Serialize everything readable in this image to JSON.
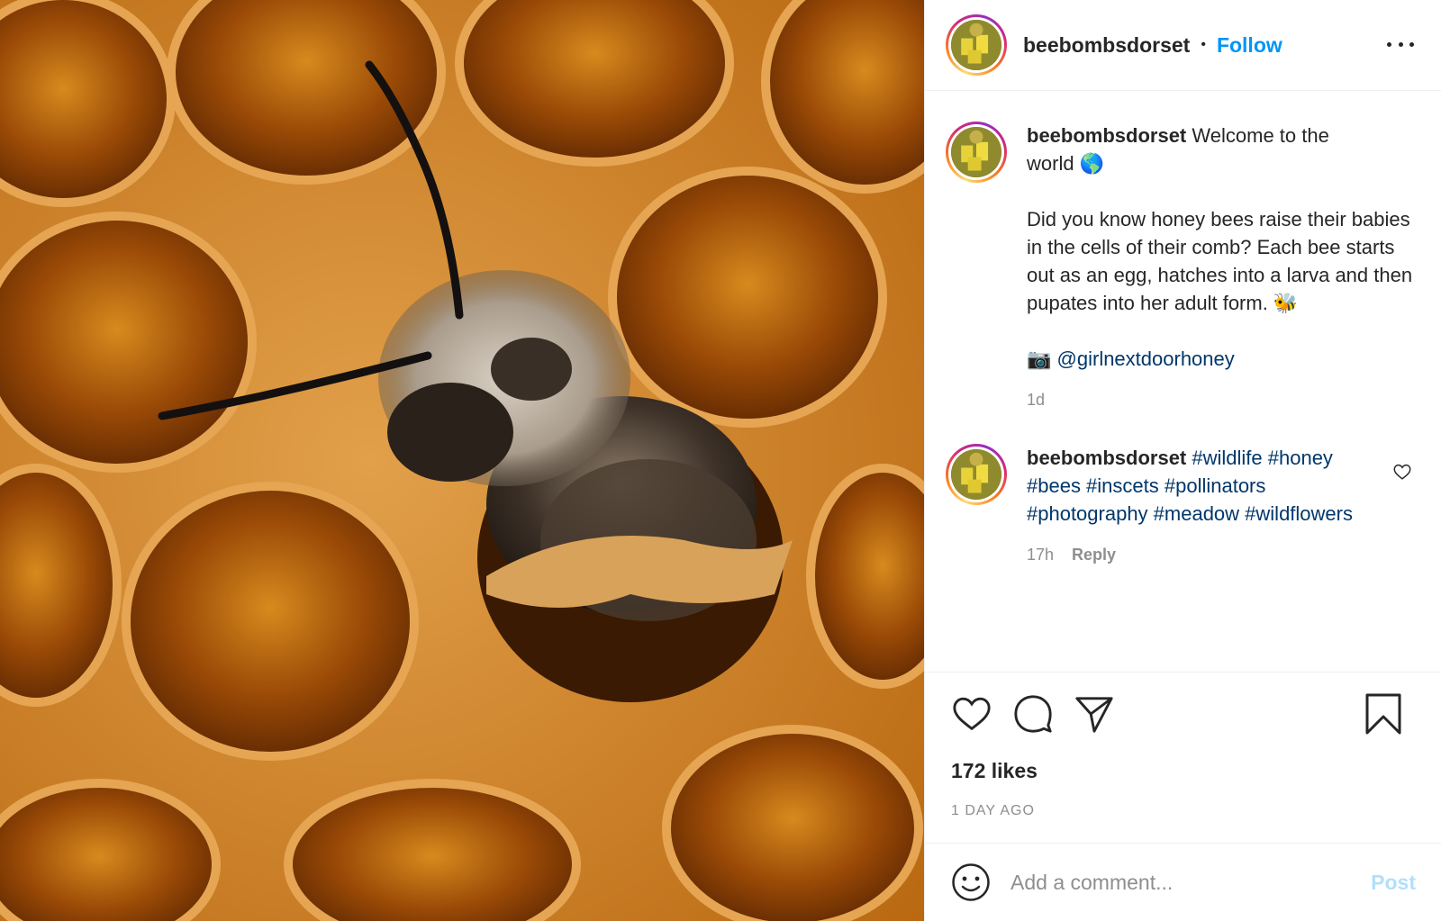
{
  "post": {
    "username": "beebombsdorset",
    "follow_label": "Follow",
    "separator": "•"
  },
  "caption": {
    "username": "beebombsdorset",
    "text_line1": "Welcome to the",
    "text_line2": "world 🌎",
    "body": "Did you know honey bees raise their babies in the cells of their comb? Each bee starts out as an egg, hatches into a larva and then pupates into her adult form. 🐝",
    "camera": "📷",
    "mention": "@girlnextdoorhoney",
    "time": "1d"
  },
  "comment": {
    "username": "beebombsdorset",
    "tags": "#wildlife #honey #bees #inscets #pollinators #photography #meadow #wildflowers",
    "time": "17h",
    "reply_label": "Reply"
  },
  "stats": {
    "likes": "172 likes",
    "posted": "1 DAY AGO"
  },
  "add_comment": {
    "placeholder": "Add a comment...",
    "post_label": "Post"
  },
  "icons": {
    "like": "heart-icon",
    "comment": "comment-bubble-icon",
    "share": "paper-plane-icon",
    "save": "bookmark-icon",
    "more": "ellipsis-icon",
    "emoji": "smiley-icon"
  },
  "colors": {
    "follow": "#0095f6",
    "hashtag": "#00376b",
    "muted": "#8e8e8e",
    "post_disabled": "#b2dffc"
  }
}
